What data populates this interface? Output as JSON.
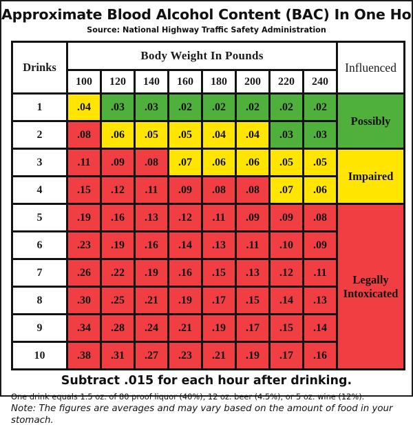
{
  "title": "Approximate Blood Alcohol Content (BAC) In One Hour",
  "subtitle": "Source: National Highway Traffic Safety Administration",
  "table": {
    "header": {
      "drinks": "Drinks",
      "body_weight": "Body Weight In Pounds",
      "influenced": "Influenced"
    },
    "weights": [
      "100",
      "120",
      "140",
      "160",
      "180",
      "200",
      "220",
      "240"
    ],
    "rows": [
      {
        "drinks": "1",
        "values": [
          ".04",
          ".03",
          ".03",
          ".02",
          ".02",
          ".02",
          ".02",
          ".02"
        ],
        "colors": [
          "yellow",
          "green",
          "green",
          "green",
          "green",
          "green",
          "green",
          "green"
        ]
      },
      {
        "drinks": "2",
        "values": [
          ".08",
          ".06",
          ".05",
          ".05",
          ".04",
          ".04",
          ".03",
          ".03"
        ],
        "colors": [
          "red",
          "yellow",
          "yellow",
          "yellow",
          "yellow",
          "yellow",
          "green",
          "green"
        ]
      },
      {
        "drinks": "3",
        "values": [
          ".11",
          ".09",
          ".08",
          ".07",
          ".06",
          ".06",
          ".05",
          ".05"
        ],
        "colors": [
          "red",
          "red",
          "red",
          "yellow",
          "yellow",
          "yellow",
          "yellow",
          "yellow"
        ]
      },
      {
        "drinks": "4",
        "values": [
          ".15",
          ".12",
          ".11",
          ".09",
          ".08",
          ".08",
          ".07",
          ".06"
        ],
        "colors": [
          "red",
          "red",
          "red",
          "red",
          "red",
          "red",
          "yellow",
          "yellow"
        ]
      },
      {
        "drinks": "5",
        "values": [
          ".19",
          ".16",
          ".13",
          ".12",
          ".11",
          ".09",
          ".09",
          ".08"
        ],
        "colors": [
          "red",
          "red",
          "red",
          "red",
          "red",
          "red",
          "red",
          "red"
        ]
      },
      {
        "drinks": "6",
        "values": [
          ".23",
          ".19",
          ".16",
          ".14",
          ".13",
          ".11",
          ".10",
          ".09"
        ],
        "colors": [
          "red",
          "red",
          "red",
          "red",
          "red",
          "red",
          "red",
          "red"
        ]
      },
      {
        "drinks": "7",
        "values": [
          ".26",
          ".22",
          ".19",
          ".16",
          ".15",
          ".13",
          ".12",
          ".11"
        ],
        "colors": [
          "red",
          "red",
          "red",
          "red",
          "red",
          "red",
          "red",
          "red"
        ]
      },
      {
        "drinks": "8",
        "values": [
          ".30",
          ".25",
          ".21",
          ".19",
          ".17",
          ".15",
          ".14",
          ".13"
        ],
        "colors": [
          "red",
          "red",
          "red",
          "red",
          "red",
          "red",
          "red",
          "red"
        ]
      },
      {
        "drinks": "9",
        "values": [
          ".34",
          ".28",
          ".24",
          ".21",
          ".19",
          ".17",
          ".15",
          ".14"
        ],
        "colors": [
          "red",
          "red",
          "red",
          "red",
          "red",
          "red",
          "red",
          "red"
        ]
      },
      {
        "drinks": "10",
        "values": [
          ".38",
          ".31",
          ".27",
          ".23",
          ".21",
          ".19",
          ".17",
          ".16"
        ],
        "colors": [
          "red",
          "red",
          "red",
          "red",
          "red",
          "red",
          "red",
          "red"
        ]
      }
    ],
    "influence_bands": [
      {
        "label": "Possibly",
        "color": "green",
        "rowspan": 2
      },
      {
        "label": "Impaired",
        "color": "yellow",
        "rowspan": 2
      },
      {
        "label": "Legally\nIntoxicated",
        "color": "red",
        "rowspan": 6
      }
    ]
  },
  "footer": {
    "bold_note": "Subtract .015 for each hour after drinking.",
    "fine_print": "One drink equals 1.5 oz. of 80 proof liquor (40%), 12 oz. beer (4.5%), or 5 oz. wine (12%).",
    "note": "Note: The figures are averages and may vary based on the amount of food in your stomach."
  },
  "colors": {
    "green": "#4fb03c",
    "yellow": "#ffe500",
    "red": "#f03e43",
    "border": "#111111",
    "text": "#111111",
    "background": "#ffffff"
  },
  "chart_data": {
    "type": "table",
    "title": "Approximate Blood Alcohol Content (BAC) In One Hour",
    "subtitle": "Source: National Highway Traffic Safety Administration",
    "xlabel": "Body Weight In Pounds",
    "ylabel": "Drinks",
    "categories": [
      "100",
      "120",
      "140",
      "160",
      "180",
      "200",
      "220",
      "240"
    ],
    "series": [
      {
        "name": "1 drink",
        "values": [
          0.04,
          0.03,
          0.03,
          0.02,
          0.02,
          0.02,
          0.02,
          0.02
        ]
      },
      {
        "name": "2 drinks",
        "values": [
          0.08,
          0.06,
          0.05,
          0.05,
          0.04,
          0.04,
          0.03,
          0.03
        ]
      },
      {
        "name": "3 drinks",
        "values": [
          0.11,
          0.09,
          0.08,
          0.07,
          0.06,
          0.06,
          0.05,
          0.05
        ]
      },
      {
        "name": "4 drinks",
        "values": [
          0.15,
          0.12,
          0.11,
          0.09,
          0.08,
          0.08,
          0.07,
          0.06
        ]
      },
      {
        "name": "5 drinks",
        "values": [
          0.19,
          0.16,
          0.13,
          0.12,
          0.11,
          0.09,
          0.09,
          0.08
        ]
      },
      {
        "name": "6 drinks",
        "values": [
          0.23,
          0.19,
          0.16,
          0.14,
          0.13,
          0.11,
          0.1,
          0.09
        ]
      },
      {
        "name": "7 drinks",
        "values": [
          0.26,
          0.22,
          0.19,
          0.16,
          0.15,
          0.13,
          0.12,
          0.11
        ]
      },
      {
        "name": "8 drinks",
        "values": [
          0.3,
          0.25,
          0.21,
          0.19,
          0.17,
          0.15,
          0.14,
          0.13
        ]
      },
      {
        "name": "9 drinks",
        "values": [
          0.34,
          0.28,
          0.24,
          0.21,
          0.19,
          0.17,
          0.15,
          0.14
        ]
      },
      {
        "name": "10 drinks",
        "values": [
          0.38,
          0.31,
          0.27,
          0.23,
          0.21,
          0.19,
          0.17,
          0.16
        ]
      }
    ],
    "legend": [
      {
        "label": "Possibly",
        "color": "#4fb03c"
      },
      {
        "label": "Impaired",
        "color": "#ffe500"
      },
      {
        "label": "Legally Intoxicated",
        "color": "#f03e43"
      }
    ],
    "annotations": [
      "Subtract .015 for each hour after drinking.",
      "One drink equals 1.5 oz. of 80 proof liquor (40%), 12 oz. beer (4.5%), or 5 oz. wine (12%).",
      "Note: The figures are averages and may vary based on the amount of food in your stomach."
    ],
    "grid": true,
    "legend_position": "right-column"
  }
}
